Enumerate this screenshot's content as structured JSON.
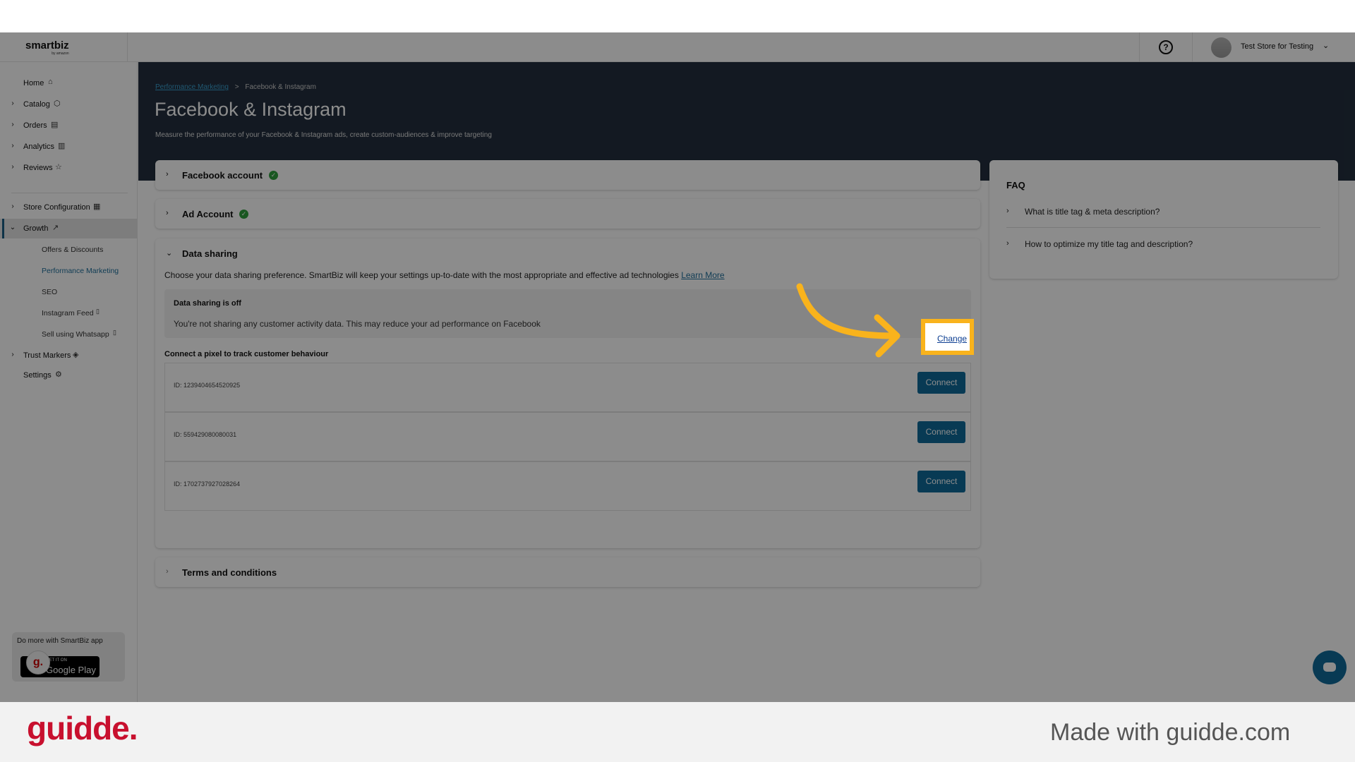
{
  "header": {
    "logo": "smartbiz",
    "logo_sub": "by amazon",
    "help_label": "?",
    "store_name": "Test Store for Testing"
  },
  "sidebar": {
    "items": [
      {
        "label": "Home",
        "icon": "home-icon"
      },
      {
        "label": "Catalog",
        "icon": "box-icon"
      },
      {
        "label": "Orders",
        "icon": "clipboard-icon"
      },
      {
        "label": "Analytics",
        "icon": "bar-chart-icon"
      },
      {
        "label": "Reviews",
        "icon": "star-icon"
      },
      {
        "label": "Store Configuration",
        "icon": "store-icon"
      },
      {
        "label": "Growth",
        "icon": "trend-icon"
      },
      {
        "label": "Offers & Discounts"
      },
      {
        "label": "Performance Marketing"
      },
      {
        "label": "SEO"
      },
      {
        "label": "Instagram Feed"
      },
      {
        "label": "Sell using Whatsapp"
      },
      {
        "label": "Trust Markers",
        "icon": "shield-icon"
      },
      {
        "label": "Settings",
        "icon": "gear-icon"
      }
    ],
    "promo": {
      "text": "Do more with SmartBiz app",
      "store_small": "GET IT ON",
      "store_big": "Google Play",
      "badge": "g."
    }
  },
  "breadcrumb": {
    "parent": "Performance Marketing",
    "sep": ">",
    "current": "Facebook & Instagram"
  },
  "page": {
    "title": "Facebook & Instagram",
    "subtitle": "Measure the performance of your Facebook & Instagram ads, create custom-audiences & improve targeting"
  },
  "sections": {
    "facebook_account": "Facebook account",
    "ad_account": "Ad Account",
    "data_sharing": "Data sharing",
    "terms": "Terms and conditions"
  },
  "data_sharing": {
    "description": "Choose your data sharing preference. SmartBiz will keep your settings up-to-date with the most appropriate and effective ad technologies",
    "learn_more": "Learn More",
    "status_title": "Data sharing is off",
    "status_desc": "You're not sharing any customer activity data. This may reduce your ad performance on Facebook",
    "change_label": "Change",
    "pixel_title": "Connect a pixel to track customer behaviour",
    "pixels": [
      {
        "id": "ID: 1239404654520925",
        "button": "Connect"
      },
      {
        "id": "ID: 559429080080031",
        "button": "Connect"
      },
      {
        "id": "ID: 1702737927028264",
        "button": "Connect"
      }
    ]
  },
  "faq": {
    "title": "FAQ",
    "items": [
      "What is title tag & meta description?",
      "How to optimize my title tag and description?"
    ]
  },
  "footer": {
    "brand": "guidde.",
    "made_with": "Made with guidde.com"
  },
  "colors": {
    "accent": "#f9b31c",
    "primary": "#0f6a9a",
    "hero": "#232f3e",
    "brand": "#c8102e"
  }
}
